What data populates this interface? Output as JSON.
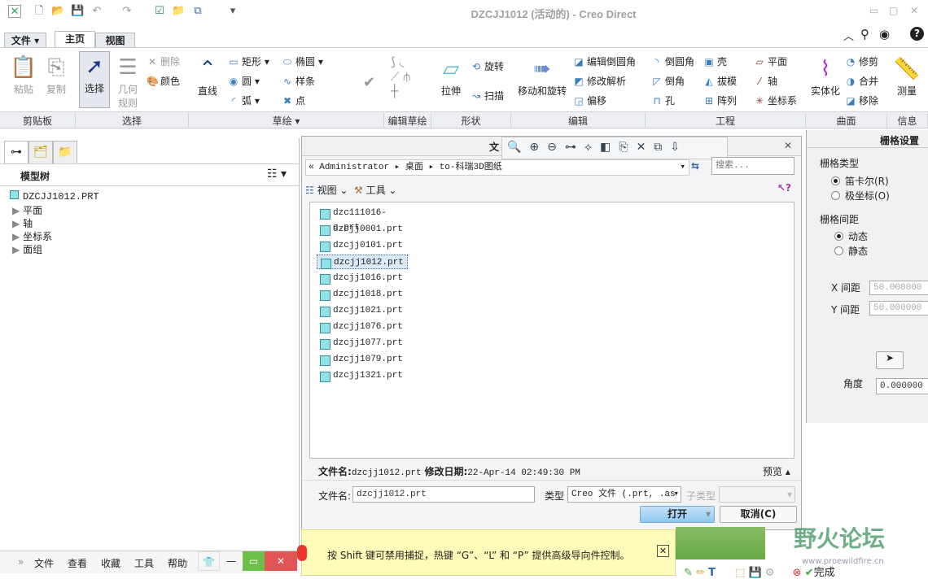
{
  "window": {
    "title": "DZCJJ1012 (活动的) - Creo Direct",
    "minimize": "▭",
    "restore": "▢",
    "close": "✕"
  },
  "quick_access": [
    "app-icon",
    "new-icon",
    "open-icon",
    "save-icon",
    "undo-icon",
    "redo-icon",
    "regenerate-icon",
    "close-window-icon",
    "windows-icon",
    "customize-icon"
  ],
  "tabs": {
    "file": "文件 ▾",
    "home": "主页",
    "view": "视图"
  },
  "help_icons": [
    "collapse-icon",
    "search-icon",
    "community-icon",
    "help-icon"
  ],
  "ribbon": {
    "clipboard": {
      "label": "剪贴板",
      "paste": "粘贴",
      "copy": "复制"
    },
    "select": {
      "label": "选择",
      "select": "选择",
      "geometry_rules": "几何规则",
      "delete": "删除",
      "color": "颜色"
    },
    "sketch": {
      "label": "草绘 ▾",
      "line": "直线",
      "rectangle": "矩形",
      "circle": "圆",
      "arc": "弧",
      "ellipse": "椭圆",
      "spline": "样条",
      "point": "点"
    },
    "edit_sketch": {
      "label": "编辑草绘"
    },
    "shape": {
      "label": "形状",
      "extrude": "拉伸",
      "revolve": "旋转",
      "sweep": "扫描"
    },
    "edit": {
      "label": "编辑",
      "move_rotate": "移动和旋转",
      "edit_round": "编辑倒圆角",
      "modify_analytic": "修改解析",
      "offset": "偏移"
    },
    "engineering": {
      "label": "工程",
      "round": "倒圆角",
      "chamfer": "倒角",
      "hole": "孔",
      "shell": "壳",
      "draft": "拔模",
      "pattern": "阵列",
      "plane": "平面",
      "axis": "轴",
      "csys": "坐标系"
    },
    "surface": {
      "label": "曲面",
      "solidify": "实体化",
      "trim": "修剪",
      "merge": "合并",
      "remove": "移除"
    },
    "info": {
      "label": "信息",
      "measure": "测量"
    }
  },
  "model_tree": {
    "title": "模型树",
    "root": "DZCJJ1012.PRT",
    "items": [
      "平面",
      "轴",
      "坐标系",
      "面组"
    ]
  },
  "dialog": {
    "title_char": "文",
    "breadcrumb": {
      "prefix": "«",
      "parts": [
        "Administrator",
        "桌面",
        "to-科瑞3D图纸"
      ]
    },
    "search_placeholder": "搜索...",
    "view_menu": "视图 ⌄",
    "tools_menu": "工具 ⌄",
    "files": [
      "dzc111016-c.prt",
      "dzcjj0001.prt",
      "dzcjj0101.prt",
      "dzcjj1012.prt",
      "dzcjj1016.prt",
      "dzcjj1018.prt",
      "dzcjj1021.prt",
      "dzcjj1076.prt",
      "dzcjj1077.prt",
      "dzcjj1079.prt",
      "dzcjj1321.prt"
    ],
    "selected_index": 3,
    "info": {
      "name_label": "文件名:",
      "name": "dzcjj1012.prt",
      "date_label": "修改日期:",
      "date": "22-Apr-14 02:49:30 PM",
      "preview": "预览 ▴"
    },
    "filename_label": "文件名:",
    "filename_value": "dzcjj1012.prt",
    "type_label": "类型",
    "type_value": "Creo 文件 (.prt, .as",
    "subtype_label": "子类型",
    "open": "打开",
    "cancel": "取消(C)",
    "close": "✕"
  },
  "grid_panel": {
    "title": "栅格设置",
    "type_label": "栅格类型",
    "cartesian": "笛卡尔(R)",
    "polar": "极坐标(O)",
    "spacing_label": "栅格间距",
    "dynamic": "动态",
    "static": "静态",
    "x_label": "X 间距",
    "x_value": "50.000000",
    "y_label": "Y 间距",
    "y_value": "50.000000",
    "angle_label": "角度",
    "angle_value": "0.000000"
  },
  "message": "按 Shift 键可禁用捕捉，热键 “G”、“L” 和 “P” 提供高级导向件控制。",
  "bottom_menu": [
    "文件",
    "查看",
    "收藏",
    "工具",
    "帮助"
  ],
  "watermark": {
    "text": "野火论坛",
    "url": "www.proewildfire.cn"
  },
  "status": {
    "done": "完成"
  },
  "colors": {
    "accent": "#3a7fc0",
    "open_button": "#a9d4f5",
    "message_bg": "#fffbb8",
    "close_red": "#e05555",
    "max_green": "#6cc04a"
  }
}
